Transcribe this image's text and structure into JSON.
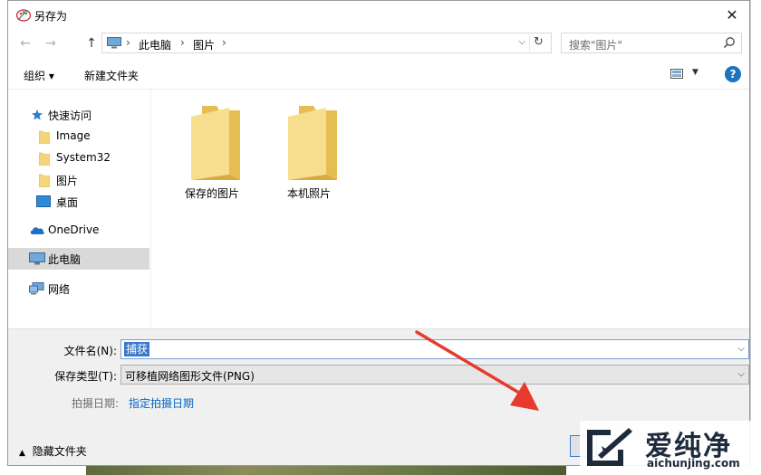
{
  "window": {
    "title": "另存为",
    "close": "✕"
  },
  "nav": {
    "back": "←",
    "forward": "→",
    "up": "↑"
  },
  "address": {
    "crumbs": [
      "此电脑",
      "图片"
    ],
    "separator": "›",
    "dropdown": "⌵",
    "refresh": "↻"
  },
  "search": {
    "placeholder": "搜索\"图片\""
  },
  "toolbar": {
    "organize": "组织 ▾",
    "new_folder": "新建文件夹",
    "view_dropdown": "▼",
    "help": "?"
  },
  "sidebar": {
    "items": [
      {
        "label": "快速访问",
        "icon": "star-icon"
      },
      {
        "label": "Image",
        "icon": "folder-icon"
      },
      {
        "label": "System32",
        "icon": "folder-icon"
      },
      {
        "label": "图片",
        "icon": "folder-icon"
      },
      {
        "label": "桌面",
        "icon": "desktop-icon"
      },
      {
        "label": "OneDrive",
        "icon": "cloud-icon"
      },
      {
        "label": "此电脑",
        "icon": "computer-icon"
      },
      {
        "label": "网络",
        "icon": "network-icon"
      }
    ]
  },
  "folders": [
    {
      "label": "保存的图片"
    },
    {
      "label": "本机照片"
    }
  ],
  "form": {
    "filename_label": "文件名(N):",
    "filename_value": "捕获",
    "filetype_label": "保存类型(T):",
    "filetype_value": "可移植网络图形文件(PNG)",
    "tags_label": "拍摄日期:",
    "tags_link": "指定拍摄日期",
    "combo_arrow": "⌵"
  },
  "footer": {
    "hide_folders": "隐藏文件夹"
  },
  "watermark": {
    "brand": "爱纯净",
    "url": "aichunjing.com"
  },
  "colors": {
    "accent": "#3b78c8",
    "link": "#0066cc",
    "folder": "#f4d57a",
    "arrow": "#e8392c"
  }
}
